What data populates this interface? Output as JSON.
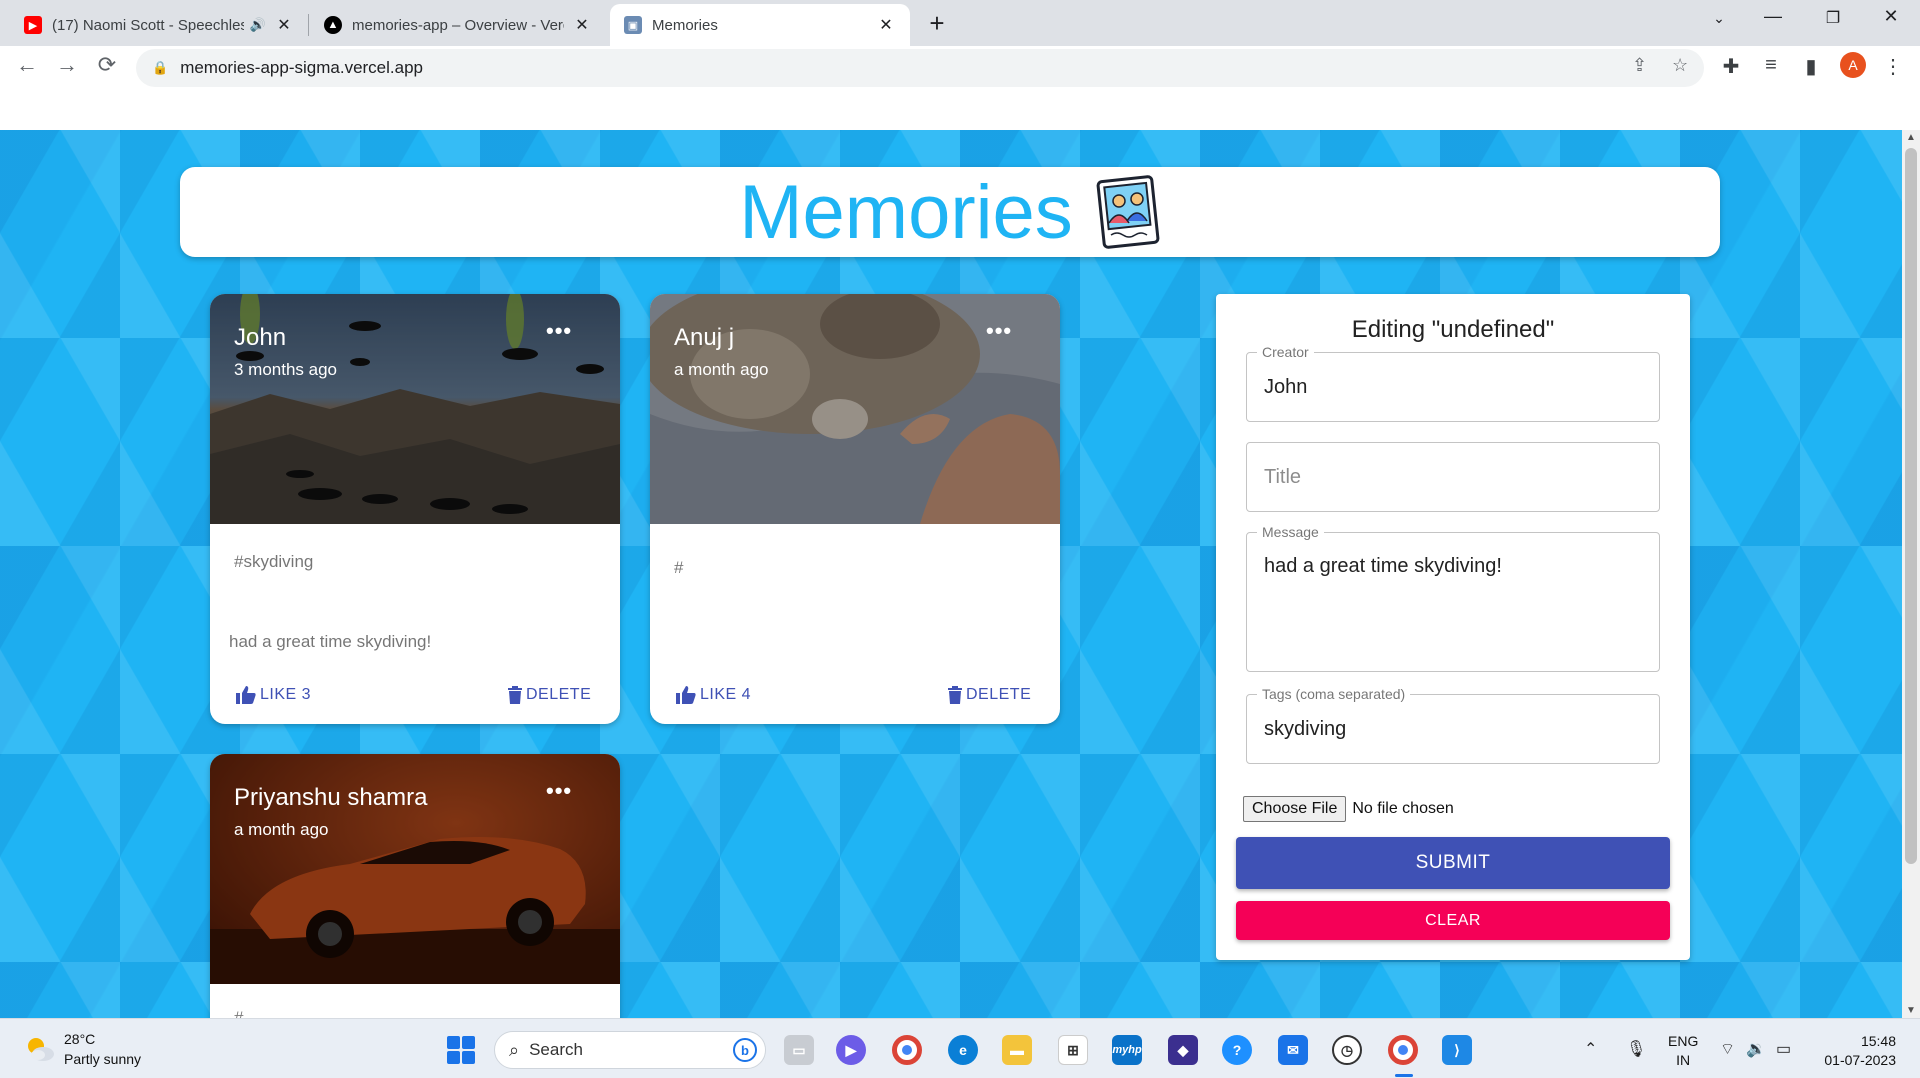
{
  "browser": {
    "tabs": [
      {
        "title": "(17) Naomi Scott - Speechless",
        "favicon": "youtube-icon",
        "audio": true
      },
      {
        "title": "memories-app – Overview - Vercel",
        "favicon": "vercel-icon"
      },
      {
        "title": "Memories",
        "favicon": "memories-favicon",
        "active": true
      }
    ],
    "url": "memories-app-sigma.vercel.app",
    "profile_initial": "A"
  },
  "app": {
    "title": "Memories",
    "accent": "#1fb4f4",
    "posts": [
      {
        "creator": "John",
        "time": "3 months ago",
        "tags": "#skydiving",
        "message": "had a great time skydiving!",
        "like_label": "LIKE 3",
        "delete_label": "DELETE",
        "image": "skydiving"
      },
      {
        "creator": "Anuj j",
        "time": "a month ago",
        "tags": "#",
        "message": "",
        "like_label": "LIKE 4",
        "delete_label": "DELETE",
        "image": "kitten"
      },
      {
        "creator": "Priyanshu shamra",
        "time": "a month ago",
        "tags": "#",
        "image": "sports-car"
      }
    ],
    "form": {
      "title": "Editing \"undefined\"",
      "creator_label": "Creator",
      "creator_value": "John",
      "title_placeholder": "Title",
      "message_label": "Message",
      "message_value": "had a great time skydiving!",
      "tags_label": "Tags (coma separated)",
      "tags_value": "skydiving",
      "file_button": "Choose File",
      "file_status": "No file chosen",
      "submit_label": "SUBMIT",
      "clear_label": "CLEAR",
      "submit_color": "#3f51b5",
      "clear_color": "#f50057"
    }
  },
  "taskbar": {
    "weather_temp": "28°C",
    "weather_desc": "Partly sunny",
    "search_label": "Search",
    "lang_line1": "ENG",
    "lang_line2": "IN",
    "time": "15:48",
    "date": "01-07-2023"
  }
}
